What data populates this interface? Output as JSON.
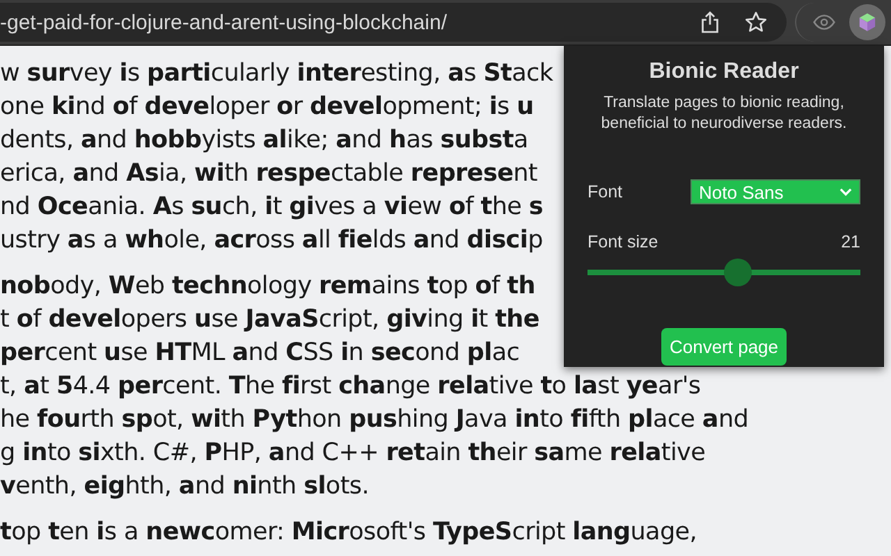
{
  "toolbar": {
    "url": "-get-paid-for-clojure-and-arent-using-blockchain/"
  },
  "article": {
    "paragraphs": [
      {
        "lines": [
          "w **sur**vey **i**s **parti**cularly **inter**esting, **a**s **St**ack",
          "one **ki**nd **o**f **deve**loper **o**r **devel**opment; **i**s **u**",
          "dents, **a**nd **hobb**yists **al**ike; **a**nd **h**as **subst**a",
          "erica, **a**nd **As**ia, **wi**th **respe**ctable **represe**nt",
          "nd **Oce**ania. **A**s **su**ch, **i**t **gi**ves a **vi**ew **o**f **t**he **s**",
          "ustry **a**s a **wh**ole, **acr**oss **a**ll **fie**lds **a**nd **disci**p"
        ]
      },
      {
        "lines": [
          "**nob**ody, **W**eb **techn**ology **rem**ains **t**op **o**f **th**",
          "t **o**f **devel**opers **u**se **JavaS**cript, **giv**ing **i**t **the**",
          "**per**cent **u**se **HT**ML **a**nd **C**SS **i**n **sec**ond **pl**ac",
          "t, **a**t **5**4.4 **per**cent. **T**he **fi**rst **cha**nge **rela**tive **t**o **la**st **ye**ar's",
          "he **fou**rth **sp**ot, **wi**th **Pyt**hon **pus**hing **J**ava **in**to **fi**fth **pl**ace **a**nd",
          "g **in**to **si**xth. C#, **P**HP, **a**nd C++ **ret**ain **th**eir **sa**me **rela**tive",
          "**v**enth, **eig**hth, **a**nd **ni**nth **sl**ots."
        ]
      },
      {
        "lines": [
          "**t**op **t**en **i**s a **newc**omer: **Micr**osoft's **TypeS**cript **lang**uage,"
        ]
      }
    ]
  },
  "popup": {
    "title": "Bionic Reader",
    "description": "Translate pages to bionic reading, beneficial to neurodiverse readers.",
    "font": {
      "label": "Font",
      "value": "Noto Sans"
    },
    "font_size": {
      "label": "Font size",
      "reading": "21",
      "level": 0.55
    },
    "button": "Convert page"
  }
}
